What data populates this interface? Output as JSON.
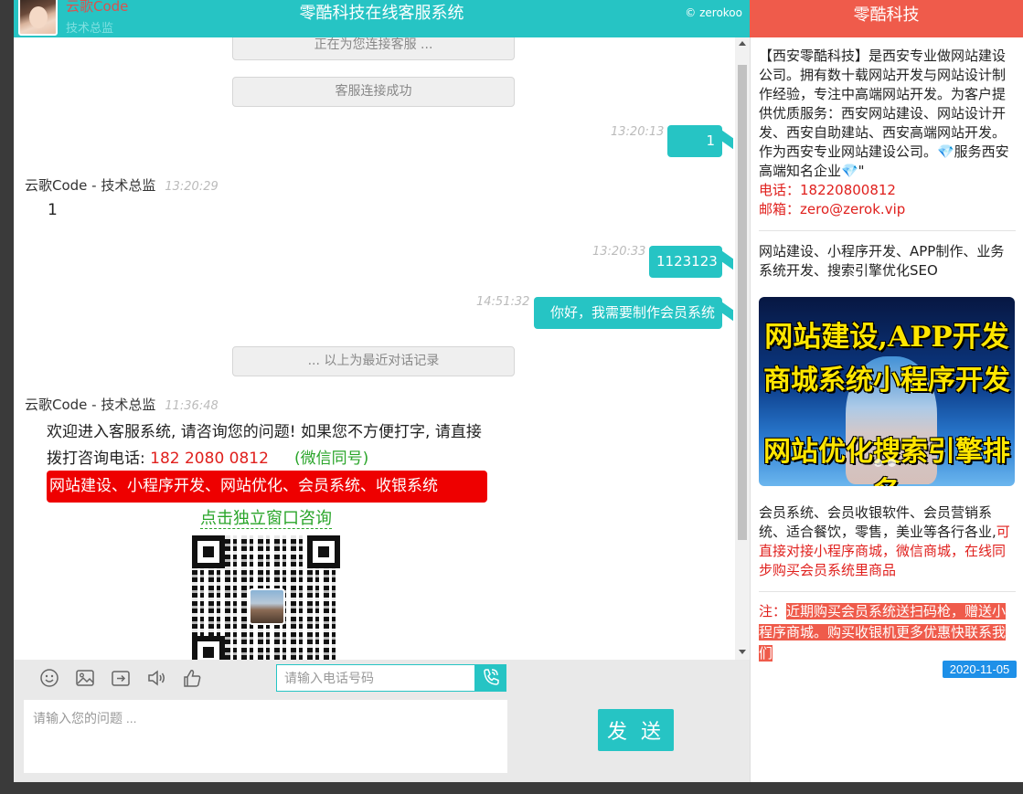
{
  "header": {
    "agent_name": "云歌Code",
    "agent_title": "技术总监",
    "title": "零酷科技在线客服系统",
    "brand": "© zerokoo"
  },
  "side_header": {
    "title": "零酷科技"
  },
  "chat": {
    "system_connecting": "正在为您连接客服 ...",
    "system_connected": "客服连接成功",
    "messages_out": [
      {
        "time": "13:20:13",
        "text": "1"
      },
      {
        "time": "13:20:33",
        "text": "1123123"
      },
      {
        "time": "14:51:32",
        "text": "你好，我需要制作会员系统"
      }
    ],
    "incoming_1": {
      "name": "云歌Code - 技术总监",
      "time": "13:20:29",
      "text": "1"
    },
    "history_marker": "... 以上为最近对话记录",
    "incoming_2": {
      "name": "云歌Code - 技术总监",
      "time": "11:36:48"
    },
    "welcome": {
      "text": "欢迎进入客服系统, 请咨询您的问题! 如果您不方便打字, 请直接拨打咨询电话:",
      "phone": "182 2080 0812",
      "wechat": "(微信同号)",
      "services": "网站建设、小程序开发、网站优化、会员系统、收银系统",
      "link": "点击独立窗口咨询"
    }
  },
  "toolbar": {
    "emoji_icon": "smiley-icon",
    "image_icon": "image-icon",
    "file_icon": "file-upload-icon",
    "sound_icon": "speaker-icon",
    "like_icon": "thumbs-up-icon",
    "phone_placeholder": "请输入电话号码",
    "phone_icon": "phone-call-icon"
  },
  "input": {
    "placeholder": "请输入您的问题 ...",
    "send_label": "发 送"
  },
  "side": {
    "intro": "【西安零酷科技】是西安专业做网站建设公司。拥有数十载网站开发与网站设计制作经验，专注中高端网站开发。为客户提供优质服务：西安网站建设、网站设计开发、西安自助建站、西安高端网站开发。作为西安专业网站建设公司。💎服务西安高端知名企业💎\"",
    "phone": "电话：18220800812",
    "email": "邮箱：zero@zerok.vip",
    "services": "网站建设、小程序开发、APP制作、业务系统开发、搜索引擎优化SEO",
    "banner_line1": "网站建设,APP开发",
    "banner_line2": "商城系统小程序开发",
    "banner_line3": "网站优化搜索引擎排名",
    "member_text": "会员系统、会员收银软件、会员营销系统、适合餐饮，零售，美业等各行各业,",
    "member_red": "可直接对接小程序商城，微信商城，在线同步购买会员系统里商品",
    "notice_label": "注：",
    "notice_text": "近期购买会员系统送扫码枪，赠送小程序商城。购买收银机更多优惠快联系我们",
    "date": "2020-11-05"
  },
  "colors": {
    "accent": "#26c4c4",
    "side_header": "#ef5b4b",
    "alert_red": "#ee0000"
  }
}
